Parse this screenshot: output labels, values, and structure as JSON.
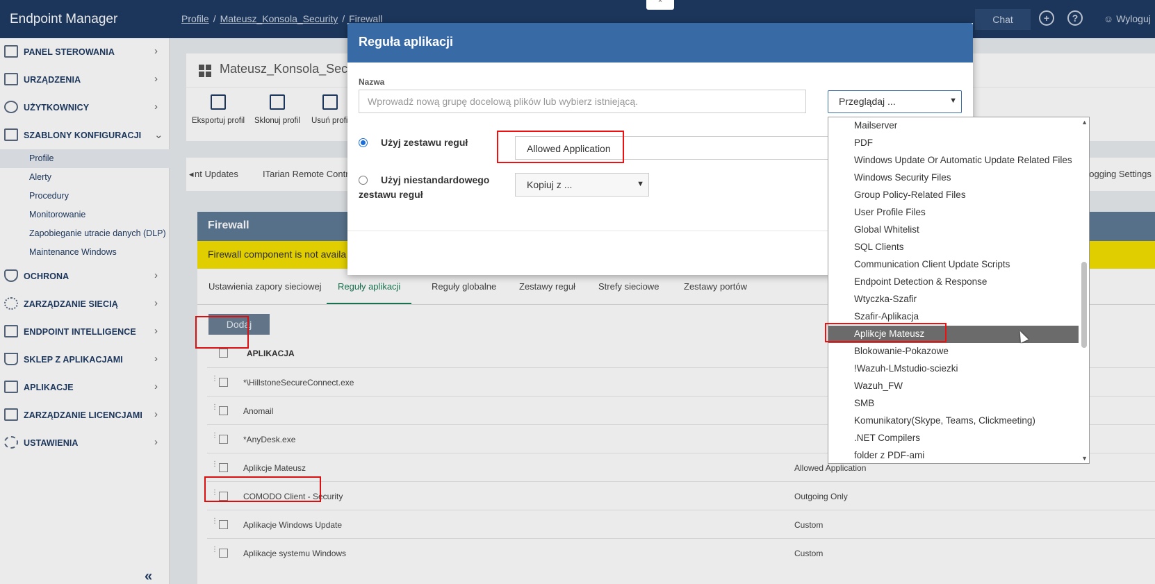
{
  "app": {
    "brand": "Endpoint Manager",
    "breadcrumb": [
      "Profile",
      "Mateusz_Konsola_Security",
      "Firewall"
    ],
    "chat": "Chat",
    "logout": "Wyloguj"
  },
  "sidebar": {
    "items": [
      {
        "label": "PANEL STEROWANIA",
        "icon": "dashboard-icon"
      },
      {
        "label": "URZĄDZENIA",
        "icon": "devices-icon"
      },
      {
        "label": "UŻYTKOWNICY",
        "icon": "user-icon"
      },
      {
        "label": "SZABLONY KONFIGURACJI",
        "icon": "templates-icon"
      },
      {
        "label": "OCHRONA",
        "icon": "shield-icon"
      },
      {
        "label": "ZARZĄDZANIE SIECIĄ",
        "icon": "network-icon"
      },
      {
        "label": "ENDPOINT INTELLIGENCE",
        "icon": "intelligence-icon"
      },
      {
        "label": "SKLEP Z APLIKACJAMI",
        "icon": "basket-icon"
      },
      {
        "label": "APLIKACJE",
        "icon": "apps-icon"
      },
      {
        "label": "ZARZĄDZANIE LICENCJAMI",
        "icon": "license-icon"
      },
      {
        "label": "USTAWIENIA",
        "icon": "gear-icon"
      }
    ],
    "subitems": [
      "Profile",
      "Alerty",
      "Procedury",
      "Monitorowanie",
      "Zapobieganie utracie danych (DLP)",
      "Maintenance Windows"
    ]
  },
  "profile": {
    "title": "Mateusz_Konsola_Sec",
    "tools": [
      "Eksportuj profil",
      "Sklonuj profil",
      "Usuń profil"
    ],
    "tabs": [
      "nt Updates",
      "ITarian Remote Contr",
      "Logging Settings"
    ]
  },
  "firewall": {
    "title": "Firewall",
    "warning": "Firewall component is not availa",
    "tabs": [
      "Ustawienia zapory sieciowej",
      "Reguły aplikacji",
      "Reguły globalne",
      "Zestawy reguł",
      "Strefy sieciowe",
      "Zestawy portów"
    ],
    "add_button": "Dodaj",
    "column_app": "APLIKACJA",
    "rows": [
      {
        "app": "*\\HillstoneSecureConnect.exe",
        "ruleset": ""
      },
      {
        "app": "Anomail",
        "ruleset": ""
      },
      {
        "app": "*AnyDesk.exe",
        "ruleset": ""
      },
      {
        "app": "Aplikcje Mateusz",
        "ruleset": "Allowed Application"
      },
      {
        "app": "COMODO Client - Security",
        "ruleset": "Outgoing Only"
      },
      {
        "app": "Aplikacje Windows Update",
        "ruleset": "Custom"
      },
      {
        "app": "Aplikacje systemu Windows",
        "ruleset": "Custom"
      }
    ]
  },
  "dialog": {
    "title": "Reguła aplikacji",
    "name_label": "Nazwa",
    "name_placeholder": "Wprowadź nową grupę docelową plików lub wybierz istniejącą.",
    "browse": "Przeglądaj ...",
    "use_ruleset": "Użyj zestawu reguł",
    "ruleset_value": "Allowed Application",
    "use_custom_line1": "Użyj niestandardowego",
    "use_custom_line2": "zestawu reguł",
    "copy_from": "Kopiuj z ..."
  },
  "dropdown": {
    "options": [
      "Mailserver",
      "PDF",
      "Windows Update Or Automatic Update Related Files",
      "Windows Security Files",
      "Group Policy-Related Files",
      "User Profile Files",
      "Global Whitelist",
      "SQL Clients",
      "Communication Client Update Scripts",
      "Endpoint Detection & Response",
      "Wtyczka-Szafir",
      "Szafir-Aplikacja",
      "Aplikcje Mateusz",
      "Blokowanie-Pokazowe",
      "!Wazuh-LMstudio-sciezki",
      "Wazuh_FW",
      "SMB",
      "Komunikatory(Skype, Teams, Clickmeeting)",
      ".NET Compilers",
      "folder z PDF-ami"
    ],
    "selected": "Aplikcje Mateusz"
  },
  "colors": {
    "topbar": "#1f3b63",
    "dialog_header": "#386aa6",
    "active_tab": "#1a7a55",
    "warning": "#f5e000",
    "highlight": "#e11111"
  }
}
